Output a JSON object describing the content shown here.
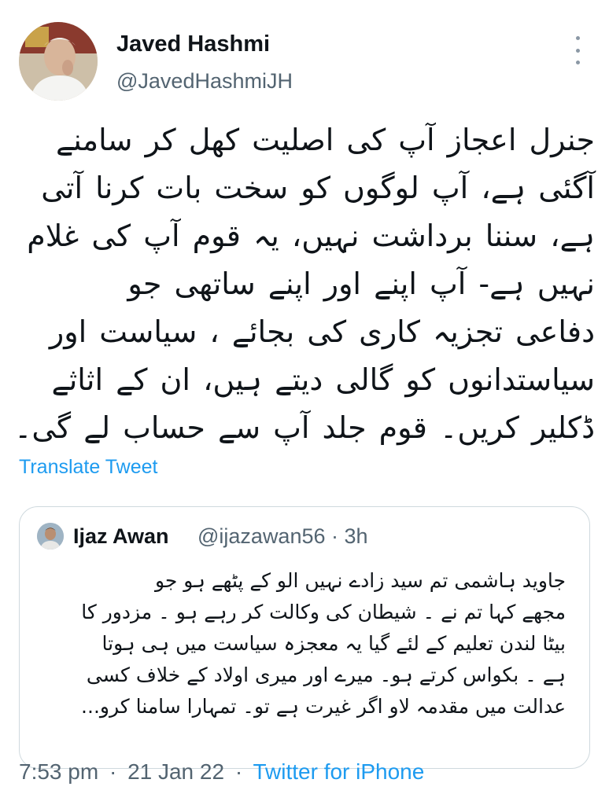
{
  "author": {
    "name": "Javed Hashmi",
    "handle": "@JavedHashmiJH",
    "avatar_icon": "user-photo-avatar",
    "more_icon": "vertical-ellipsis-icon"
  },
  "tweet": {
    "lines": [
      "جنرل اعجاز آپ کی اصلیت کھل کر سامنے",
      "آگئی ہے، آپ لوگوں کو سخت بات کرنا آتی",
      "ہے، سننا برداشت نہیں، یہ قوم آپ کی غلام",
      "نہیں ہے- آپ اپنے اور اپنے ساتھی جو",
      "دفاعی تجزیہ کاری کی بجائے ، سیاست اور",
      "سیاستدانوں کو گالی دیتے ہیں، ان کے اثاثے",
      "ڈکلیر کریں۔ قوم جلد آپ سے حساب لے گی۔"
    ],
    "translate_label": "Translate Tweet"
  },
  "quoted_tweet": {
    "name": "Ijaz Awan",
    "meta": "@ijazawan56 · 3h",
    "lines": [
      "جاوید ہاشمی  تم سید زادے نہیں الو کے پٹھے ہو جو",
      "مجھے کہا تم نے ۔ شیطان کی وکالت کر رہے ہو  ۔ مزدور کا",
      "بیٹا لندن تعلیم کے لئے گیا  یہ معجزہ سیاست میں ہی ہوتا",
      "ہے ۔ بکواس کرتے ہو۔ میرے اور میری اولاد کے خلاف کسی",
      "عدالت میں مقدمہ لاو اگر غیرت ہے تو۔ تمہارا سامنا کرو..."
    ]
  },
  "footer": {
    "time": "7:53 pm",
    "date": "21 Jan 22",
    "separator": "·",
    "source": "Twitter for iPhone"
  },
  "colors": {
    "link": "#1d9bf0",
    "secondary_text": "#536471",
    "border": "#cfd9de"
  }
}
